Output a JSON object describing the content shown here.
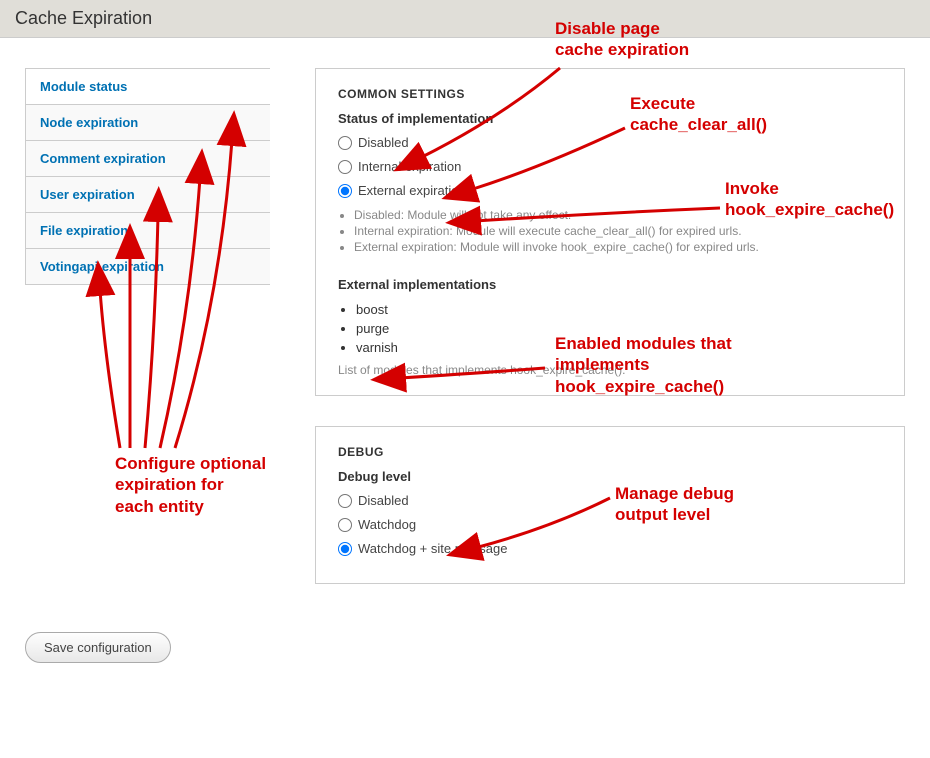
{
  "header": {
    "title": "Cache Expiration"
  },
  "sidebar": {
    "tabs": [
      {
        "label": "Module status"
      },
      {
        "label": "Node expiration"
      },
      {
        "label": "Comment expiration"
      },
      {
        "label": "User expiration"
      },
      {
        "label": "File expiration"
      },
      {
        "label": "Votingapi expiration"
      }
    ]
  },
  "common": {
    "panel_title": "COMMON SETTINGS",
    "status_label": "Status of implementation",
    "options": {
      "disabled": "Disabled",
      "internal": "Internal expiration",
      "external": "External expiration"
    },
    "desc": [
      "Disabled: Module will not take any effect.",
      "Internal expiration: Module will execute cache_clear_all() for expired urls.",
      "External expiration: Module will invoke hook_expire_cache() for expired urls."
    ],
    "ext_label": "External implementations",
    "ext_items": [
      "boost",
      "purge",
      "varnish"
    ],
    "ext_hint": "List of modules that implements hook_expire_cache()."
  },
  "debug": {
    "panel_title": "DEBUG",
    "level_label": "Debug level",
    "options": {
      "disabled": "Disabled",
      "watchdog": "Watchdog",
      "watchdog_site": "Watchdog + site message"
    }
  },
  "actions": {
    "save": "Save configuration"
  },
  "annotations": {
    "a1": "Disable page\ncache expiration",
    "a2": "Execute\ncache_clear_all()",
    "a3": "Invoke\nhook_expire_cache()",
    "a4": "Enabled modules that\nimplements\nhook_expire_cache()",
    "a5": "Configure optional\nexpiration for\neach entity",
    "a6": "Manage debug\noutput level"
  }
}
